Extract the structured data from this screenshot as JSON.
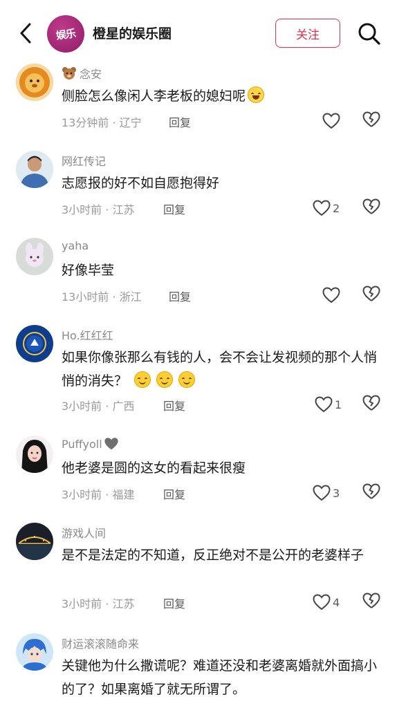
{
  "header": {
    "channel_logo": "娱乐",
    "channel_title": "橙星的娱乐圈",
    "follow_label": "关注",
    "icons": [
      "chevron-left-icon",
      "search-icon"
    ]
  },
  "reply_label": "回复",
  "colors": {
    "accent": "#e0304f",
    "meta_gray": "#9a9a9a",
    "username_gray": "#8a8a8a"
  },
  "comments": [
    {
      "username": "念安",
      "username_prefix_icon": "teddy-bear-icon",
      "content": "侧脸怎么像闲人李老板的媳妇呢",
      "content_suffix_icon": "crying-laughing-emoji",
      "meta": "13分钟前 · 辽宁",
      "likes": ""
    },
    {
      "username": "网红传记",
      "content": "志愿报的好不如自愿抱得好",
      "meta": "3小时前 · 江苏",
      "likes": "2"
    },
    {
      "username": "yaha",
      "content": "好像毕莹",
      "meta": "13小时前 · 浙江",
      "likes": ""
    },
    {
      "username": "Ho.红红红",
      "content": "如果你像张那么有钱的人，会不会让发视频的那个人悄悄的消失？",
      "content_suffix_icon": "smile-emoji x3",
      "meta": "3小时前 · 广西",
      "likes": "1"
    },
    {
      "username": "Puffyoll",
      "username_suffix_icon": "gray-heart-icon",
      "content": "他老婆是圆的这女的看起来很瘦",
      "meta": "3小时前 · 福建",
      "likes": "3"
    },
    {
      "username": "游戏人间",
      "content": "是不是法定的不知道，反正绝对不是公开的老婆样子",
      "meta": "3小时前 · 江苏",
      "likes": "4"
    },
    {
      "username": "财运滚滚随命来",
      "content": "关键他为什么撒谎呢？难道还没和老婆离婚就外面搞小的了？如果离婚了就无所谓了。",
      "meta": "",
      "likes": ""
    }
  ]
}
